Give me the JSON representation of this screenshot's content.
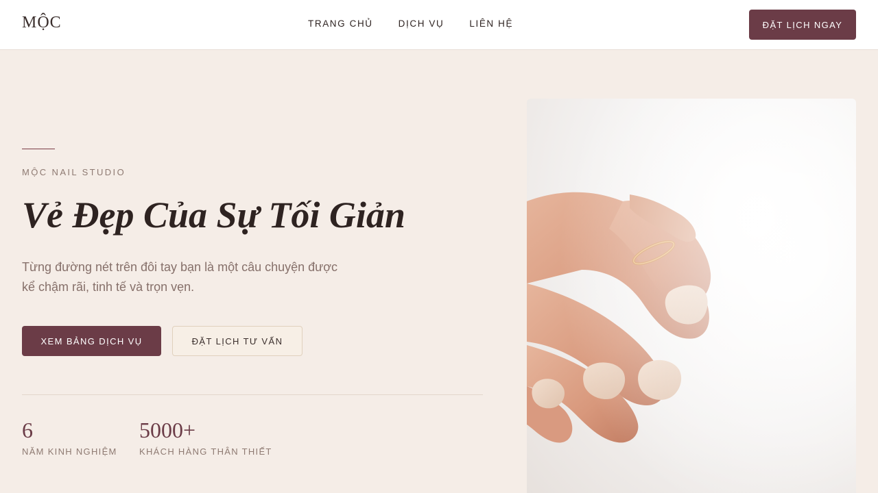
{
  "header": {
    "logo": "MỘC",
    "nav": [
      {
        "label": "TRANG CHỦ"
      },
      {
        "label": "DỊCH VỤ"
      },
      {
        "label": "LIÊN HỆ"
      }
    ],
    "cta_label": "ĐẶT LỊCH NGAY"
  },
  "hero": {
    "eyebrow": "MỘC NAIL STUDIO",
    "title": "Vẻ Đẹp Của Sự Tối Giản",
    "description": "Từng đường nét trên đôi tay bạn là một câu chuyện được kể chậm rãi, tinh tế và trọn vẹn.",
    "primary_button": "XEM BẢNG DỊCH VỤ",
    "secondary_button": "ĐẶT LỊCH TƯ VẤN",
    "stats": [
      {
        "value": "6",
        "label": "NĂM KINH NGHIỆM"
      },
      {
        "value": "5000+",
        "label": "KHÁCH HÀNG THÂN THIẾT"
      }
    ],
    "image_subject": "hand-with-gold-ring-and-nude-manicure"
  },
  "colors": {
    "accent": "#6b3c47",
    "background": "#f5ede7",
    "header_bg": "#ffffff",
    "muted_text": "#8e7a72"
  }
}
